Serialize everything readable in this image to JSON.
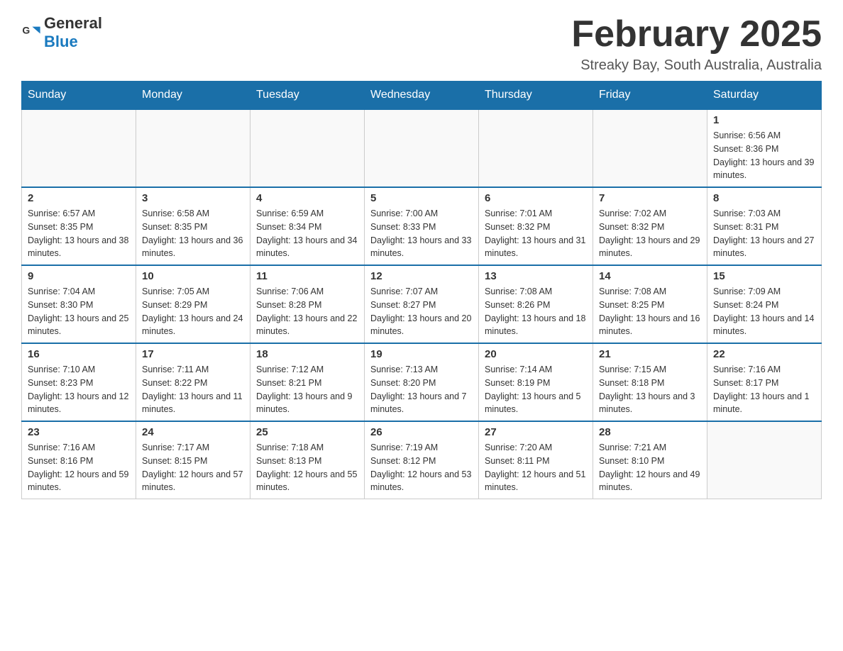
{
  "logo": {
    "general": "General",
    "blue": "Blue"
  },
  "title": "February 2025",
  "subtitle": "Streaky Bay, South Australia, Australia",
  "weekdays": [
    "Sunday",
    "Monday",
    "Tuesday",
    "Wednesday",
    "Thursday",
    "Friday",
    "Saturday"
  ],
  "weeks": [
    [
      {
        "day": "",
        "info": ""
      },
      {
        "day": "",
        "info": ""
      },
      {
        "day": "",
        "info": ""
      },
      {
        "day": "",
        "info": ""
      },
      {
        "day": "",
        "info": ""
      },
      {
        "day": "",
        "info": ""
      },
      {
        "day": "1",
        "info": "Sunrise: 6:56 AM\nSunset: 8:36 PM\nDaylight: 13 hours and 39 minutes."
      }
    ],
    [
      {
        "day": "2",
        "info": "Sunrise: 6:57 AM\nSunset: 8:35 PM\nDaylight: 13 hours and 38 minutes."
      },
      {
        "day": "3",
        "info": "Sunrise: 6:58 AM\nSunset: 8:35 PM\nDaylight: 13 hours and 36 minutes."
      },
      {
        "day": "4",
        "info": "Sunrise: 6:59 AM\nSunset: 8:34 PM\nDaylight: 13 hours and 34 minutes."
      },
      {
        "day": "5",
        "info": "Sunrise: 7:00 AM\nSunset: 8:33 PM\nDaylight: 13 hours and 33 minutes."
      },
      {
        "day": "6",
        "info": "Sunrise: 7:01 AM\nSunset: 8:32 PM\nDaylight: 13 hours and 31 minutes."
      },
      {
        "day": "7",
        "info": "Sunrise: 7:02 AM\nSunset: 8:32 PM\nDaylight: 13 hours and 29 minutes."
      },
      {
        "day": "8",
        "info": "Sunrise: 7:03 AM\nSunset: 8:31 PM\nDaylight: 13 hours and 27 minutes."
      }
    ],
    [
      {
        "day": "9",
        "info": "Sunrise: 7:04 AM\nSunset: 8:30 PM\nDaylight: 13 hours and 25 minutes."
      },
      {
        "day": "10",
        "info": "Sunrise: 7:05 AM\nSunset: 8:29 PM\nDaylight: 13 hours and 24 minutes."
      },
      {
        "day": "11",
        "info": "Sunrise: 7:06 AM\nSunset: 8:28 PM\nDaylight: 13 hours and 22 minutes."
      },
      {
        "day": "12",
        "info": "Sunrise: 7:07 AM\nSunset: 8:27 PM\nDaylight: 13 hours and 20 minutes."
      },
      {
        "day": "13",
        "info": "Sunrise: 7:08 AM\nSunset: 8:26 PM\nDaylight: 13 hours and 18 minutes."
      },
      {
        "day": "14",
        "info": "Sunrise: 7:08 AM\nSunset: 8:25 PM\nDaylight: 13 hours and 16 minutes."
      },
      {
        "day": "15",
        "info": "Sunrise: 7:09 AM\nSunset: 8:24 PM\nDaylight: 13 hours and 14 minutes."
      }
    ],
    [
      {
        "day": "16",
        "info": "Sunrise: 7:10 AM\nSunset: 8:23 PM\nDaylight: 13 hours and 12 minutes."
      },
      {
        "day": "17",
        "info": "Sunrise: 7:11 AM\nSunset: 8:22 PM\nDaylight: 13 hours and 11 minutes."
      },
      {
        "day": "18",
        "info": "Sunrise: 7:12 AM\nSunset: 8:21 PM\nDaylight: 13 hours and 9 minutes."
      },
      {
        "day": "19",
        "info": "Sunrise: 7:13 AM\nSunset: 8:20 PM\nDaylight: 13 hours and 7 minutes."
      },
      {
        "day": "20",
        "info": "Sunrise: 7:14 AM\nSunset: 8:19 PM\nDaylight: 13 hours and 5 minutes."
      },
      {
        "day": "21",
        "info": "Sunrise: 7:15 AM\nSunset: 8:18 PM\nDaylight: 13 hours and 3 minutes."
      },
      {
        "day": "22",
        "info": "Sunrise: 7:16 AM\nSunset: 8:17 PM\nDaylight: 13 hours and 1 minute."
      }
    ],
    [
      {
        "day": "23",
        "info": "Sunrise: 7:16 AM\nSunset: 8:16 PM\nDaylight: 12 hours and 59 minutes."
      },
      {
        "day": "24",
        "info": "Sunrise: 7:17 AM\nSunset: 8:15 PM\nDaylight: 12 hours and 57 minutes."
      },
      {
        "day": "25",
        "info": "Sunrise: 7:18 AM\nSunset: 8:13 PM\nDaylight: 12 hours and 55 minutes."
      },
      {
        "day": "26",
        "info": "Sunrise: 7:19 AM\nSunset: 8:12 PM\nDaylight: 12 hours and 53 minutes."
      },
      {
        "day": "27",
        "info": "Sunrise: 7:20 AM\nSunset: 8:11 PM\nDaylight: 12 hours and 51 minutes."
      },
      {
        "day": "28",
        "info": "Sunrise: 7:21 AM\nSunset: 8:10 PM\nDaylight: 12 hours and 49 minutes."
      },
      {
        "day": "",
        "info": ""
      }
    ]
  ]
}
